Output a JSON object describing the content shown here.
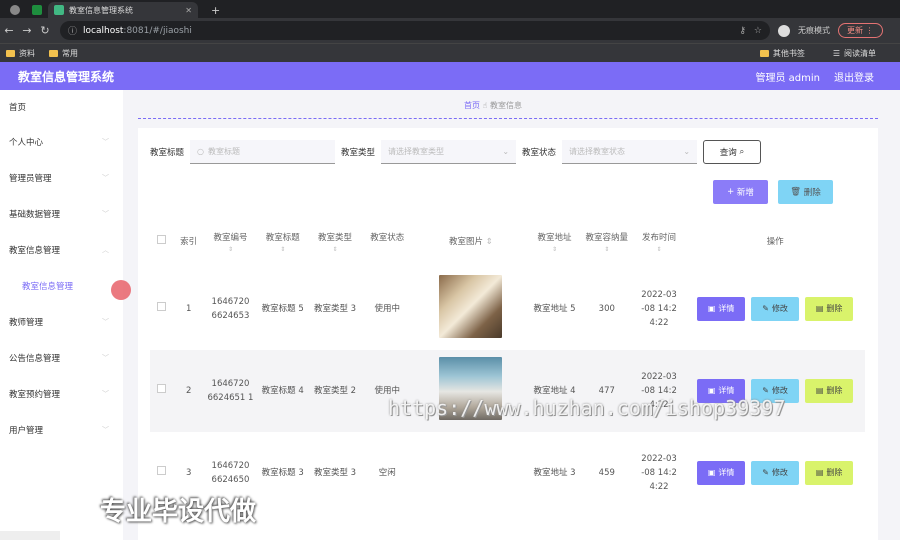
{
  "browser": {
    "active_tab_title": "教室信息管理系统",
    "url_host": "localhost",
    "url_path": ":8081/#/jiaoshi",
    "incognito_label": "无痕模式",
    "update_label": "更新",
    "bookmarks": [
      "资料",
      "常用"
    ],
    "bookmarks_right": [
      "其他书签",
      "阅读清单"
    ]
  },
  "header": {
    "title": "教室信息管理系统",
    "user_label": "管理员 admin",
    "logout_label": "退出登录"
  },
  "sidebar": {
    "items": [
      {
        "label": "首页"
      },
      {
        "label": "个人中心"
      },
      {
        "label": "管理员管理"
      },
      {
        "label": "基础数据管理"
      },
      {
        "label": "教室信息管理"
      },
      {
        "label": "教室信息管理"
      },
      {
        "label": "教师管理"
      },
      {
        "label": "公告信息管理"
      },
      {
        "label": "教室预约管理"
      },
      {
        "label": "用户管理"
      }
    ]
  },
  "breadcrumb": {
    "home": "首页",
    "current": "教室信息"
  },
  "filters": {
    "title_label": "教室标题",
    "title_placeholder": "教室标题",
    "type_label": "教室类型",
    "type_placeholder": "请选择教室类型",
    "status_label": "教室状态",
    "status_placeholder": "请选择教室状态",
    "query_label": "查询"
  },
  "actions": {
    "new_label": "新增",
    "delete_label": "删除"
  },
  "table": {
    "headers": [
      "索引",
      "教室编号",
      "教室标题",
      "教室类型",
      "教室状态",
      "教室图片",
      "教室地址",
      "教室容纳量",
      "发布时间",
      "操作"
    ],
    "rows": [
      {
        "index": "1",
        "number": "1646720 6624653",
        "title": "教室标题 5",
        "type": "教室类型 3",
        "status": "使用中",
        "address": "教室地址 5",
        "capacity": "300",
        "time": "2022-03 -08 14:2 4:22"
      },
      {
        "index": "2",
        "number": "1646720 6624651 1",
        "title": "教室标题 4",
        "type": "教室类型 2",
        "status": "使用中",
        "address": "教室地址 4",
        "capacity": "477",
        "time": "2022-03 -08 14:2 4:22"
      },
      {
        "index": "3",
        "number": "1646720 6624650",
        "title": "教室标题 3",
        "type": "教室类型 3",
        "status": "空闲",
        "address": "教室地址 3",
        "capacity": "459",
        "time": "2022-03 -08 14:2 4:22"
      }
    ],
    "op_detail": "详情",
    "op_edit": "修改",
    "op_delete": "删除"
  },
  "overlay": {
    "watermark": "https://www.huzhan.com/ishop39397",
    "promo": "专业毕设代做"
  }
}
